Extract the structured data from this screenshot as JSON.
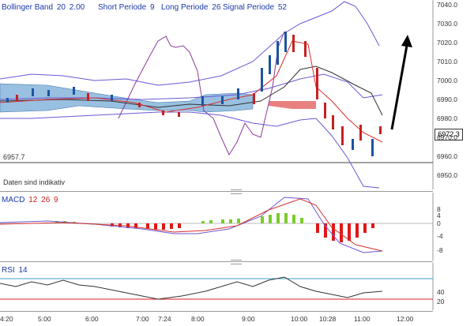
{
  "main": {
    "bollinger_label": "Bollinger Band",
    "bollinger_period": "20",
    "bollinger_dev": "2.00",
    "short_label": "Short Periode",
    "short_value": "9",
    "long_label": "Long Periode",
    "long_value": "26",
    "signal_label": "Signal Periode",
    "signal_value": "52",
    "level_label": "6957.7",
    "indicative_note": "Daten sind indikativ",
    "price_tag": "6972.3",
    "y_ticks": [
      "7040.0",
      "7030.0",
      "7020.0",
      "7010.0",
      "7000.0",
      "6990.0",
      "6980.0",
      "6970.0",
      "6960.0",
      "6950.0"
    ]
  },
  "macd": {
    "label": "MACD",
    "p1": "12",
    "p2": "26",
    "p3": "9",
    "y_ticks": [
      "8",
      "4",
      "0",
      "-4",
      "-8"
    ]
  },
  "rsi": {
    "label": "RSI",
    "period": "14",
    "y_ticks": [
      "40",
      "20"
    ]
  },
  "x_axis": {
    "ticks": [
      "4:20",
      "5:00",
      "6:00",
      "7:00",
      "7:24",
      "8:00",
      "9:00",
      "10:00",
      "10:28",
      "11:00",
      "12:00"
    ]
  },
  "colors": {
    "band": "#6b58d6",
    "macd_hist_pos": "#7acc2a",
    "macd_hist_neg": "#e01818",
    "candle_up": "#1a55a0",
    "candle_down": "#c62020",
    "cloud": "#7fb0d8"
  }
}
